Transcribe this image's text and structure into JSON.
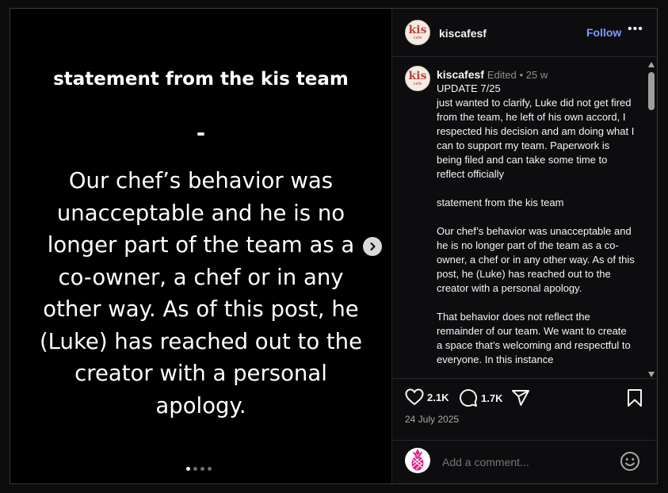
{
  "media": {
    "title": "statement from the kis team",
    "dash": "-",
    "body": "Our chef’s behavior was unacceptable and he is no longer part of the team as a co-owner, a chef or in any other way. As of this post, he (Luke) has reached out to the creator with a personal apology.",
    "slide_count": 4,
    "active_slide": 1
  },
  "post": {
    "username": "kiscafesf",
    "follow_label": "Follow",
    "avatar_text_main": "kis",
    "avatar_text_sub": "cafe",
    "caption": {
      "username": "kiscafesf",
      "edited": "Edited",
      "age": "25 w",
      "text": "UPDATE 7/25\njust wanted to clarify, Luke did not get fired from the team, he left of his own accord, I respected his decision and am doing what I can to support my team. Paperwork is being filed and can take some time to reflect officially\n\nstatement from the kis team\n\nOur chef’s behavior was unacceptable and he is no longer part of the team as a co-owner, a chef or in any other way. As of this post, he (Luke) has reached out to the creator with a personal apology.\n\nThat behavior does not reflect the remainder of our team. We want to create a space that’s welcoming and respectful to everyone. In this instance"
    },
    "likes": "2.1K",
    "comments": "1.7K",
    "date": "24 July 2025",
    "comment_placeholder": "Add a comment..."
  },
  "colors": {
    "follow": "#7b9cff",
    "avatar_brand": "#b5473f",
    "comment_avatar": "#e0218a"
  }
}
